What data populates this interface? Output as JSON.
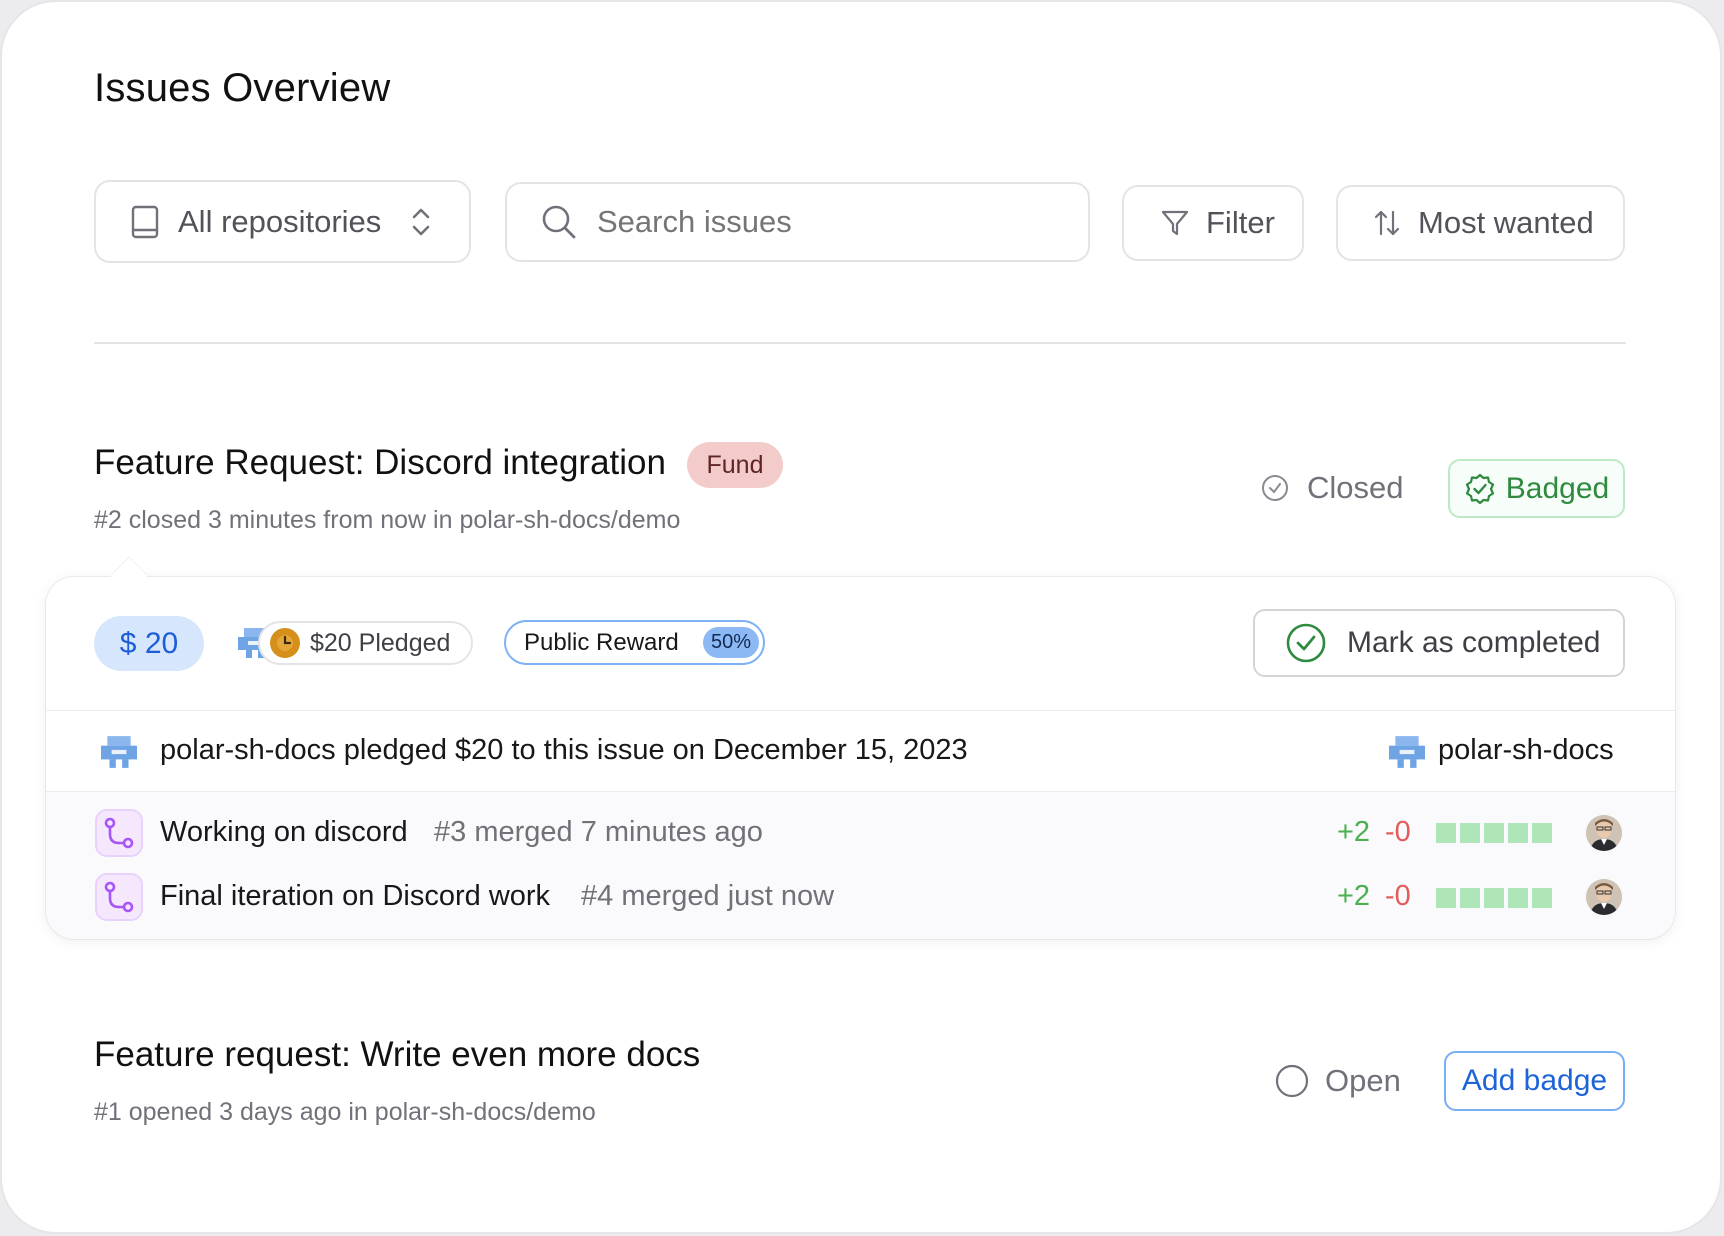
{
  "page": {
    "title": "Issues Overview"
  },
  "toolbar": {
    "repo_select": {
      "value": "All repositories",
      "icon": "book-icon",
      "chevron": "chevron-up-down-icon"
    },
    "search": {
      "placeholder": "Search issues",
      "icon": "search-icon"
    },
    "filter": {
      "label": "Filter",
      "icon": "funnel-icon"
    },
    "sort": {
      "label": "Most wanted",
      "icon": "sort-arrows-icon"
    }
  },
  "issues": [
    {
      "title": "Feature Request: Discord integration",
      "badge": "Fund",
      "meta": "#2 closed 3 minutes from now in polar-sh-docs/demo",
      "status": "Closed",
      "action": "Badged",
      "pledge": {
        "amount": "$ 20",
        "pledged_label": "$20 Pledged",
        "reward_label": "Public Reward",
        "reward_percent": "50%",
        "complete_label": "Mark as completed",
        "activity": "polar-sh-docs pledged $20 to this issue on December 15, 2023",
        "org": "polar-sh-docs",
        "pull_requests": [
          {
            "title": "Working on discord",
            "meta": "#3 merged 7 minutes ago",
            "additions": "+2",
            "deletions": "-0",
            "diff_bars": 5
          },
          {
            "title": "Final iteration on Discord work",
            "meta": "#4 merged just now",
            "additions": "+2",
            "deletions": "-0",
            "diff_bars": 5
          }
        ]
      }
    },
    {
      "title": "Feature request: Write even more docs",
      "meta": "#1 opened 3 days ago in polar-sh-docs/demo",
      "status": "Open",
      "action": "Add badge"
    }
  ],
  "colors": {
    "fund_badge_bg": "#f3cbcb",
    "badged_green": "#2e8a3f",
    "amount_blue": "#1d5ed8",
    "pr_purple": "#a855f7",
    "additions_green": "#4caf50",
    "deletions_red": "#e25c5c",
    "link_blue": "#1d64d8"
  }
}
